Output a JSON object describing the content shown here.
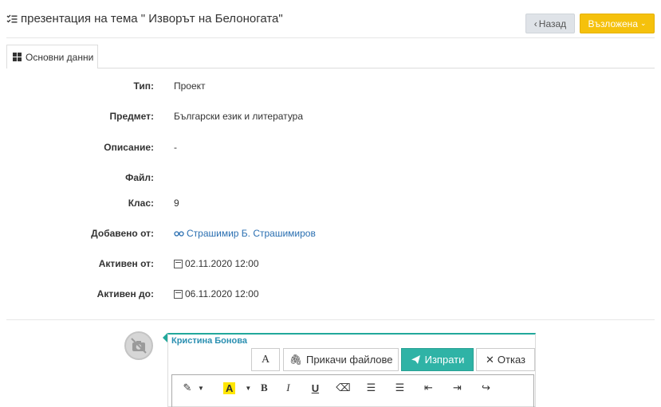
{
  "header": {
    "title": "презентация на тема \" Изворът на Белоногата\"",
    "back_label": "Назад",
    "status_label": "Възложена",
    "status_color": "#f5c10c"
  },
  "tabs": [
    {
      "label": "Основни данни"
    }
  ],
  "details": [
    {
      "label": "Тип:",
      "value": "Проект"
    },
    {
      "label": "Предмет:",
      "value": "Български език и литература"
    },
    {
      "label": "Описание:",
      "value": "-"
    },
    {
      "label": "Файл:",
      "value": ""
    },
    {
      "label": "Клас:",
      "value": "9"
    },
    {
      "label": "Добавено от:",
      "value": "Страшимир Б. Страшимиров"
    },
    {
      "label": "Активен от:",
      "value": "02.11.2020 12:00"
    },
    {
      "label": "Активен до:",
      "value": "06.11.2020 12:00"
    }
  ],
  "comment": {
    "author": "Кристина Бонова",
    "font_label": "A",
    "attach_label": "Прикачи файлове",
    "send_label": "Изпрати",
    "cancel_label": "Отказ",
    "accent_color": "#2fb3a6"
  },
  "editor_tools": [
    {
      "icon": "magic-wand-icon"
    },
    {
      "icon": "highlight-color-icon",
      "text": "A"
    },
    {
      "icon": "bold-icon",
      "text": "B"
    },
    {
      "icon": "italic-icon",
      "text": "I"
    },
    {
      "icon": "underline-icon",
      "text": "U"
    },
    {
      "icon": "eraser-icon"
    },
    {
      "icon": "bulleted-list-icon"
    },
    {
      "icon": "numbered-list-icon"
    },
    {
      "icon": "outdent-icon"
    },
    {
      "icon": "indent-icon"
    },
    {
      "icon": "redo-icon"
    }
  ]
}
